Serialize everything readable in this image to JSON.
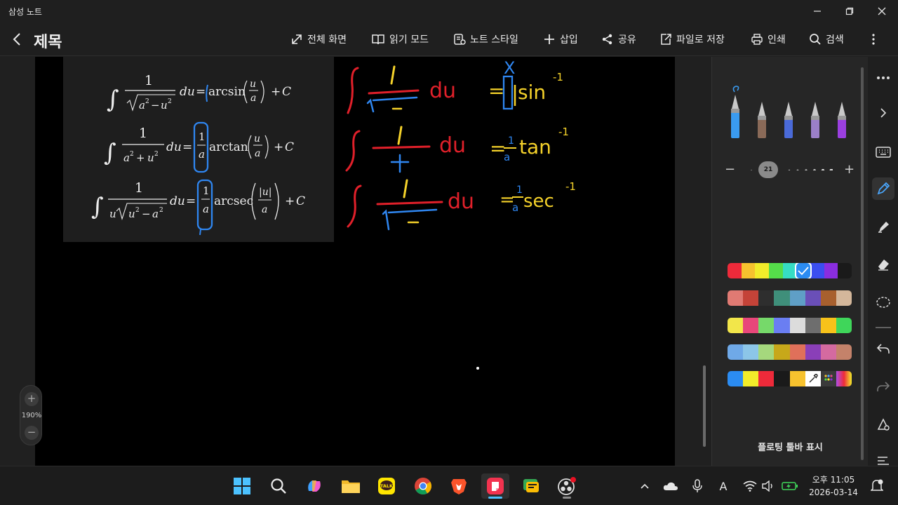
{
  "window": {
    "title": "삼성 노트",
    "controls": [
      "minimize",
      "restore",
      "close"
    ]
  },
  "toolbar": {
    "page_title": "제목",
    "items": [
      {
        "id": "fullscreen",
        "label": "전체 화면",
        "icon": "expand-icon"
      },
      {
        "id": "reading",
        "label": "읽기 모드",
        "icon": "book-icon"
      },
      {
        "id": "style",
        "label": "노트 스타일",
        "icon": "note-style-icon"
      },
      {
        "id": "insert",
        "label": "삽입",
        "icon": "plus-icon"
      },
      {
        "id": "share",
        "label": "공유",
        "icon": "share-icon"
      },
      {
        "id": "save",
        "label": "파일로 저장",
        "icon": "save-file-icon"
      },
      {
        "id": "print",
        "label": "인쇄",
        "icon": "print-icon"
      },
      {
        "id": "search",
        "label": "검색",
        "icon": "search-icon"
      }
    ]
  },
  "formulas": [
    {
      "integrand_num": "1",
      "integrand_den": "√(a² − u²)",
      "result_coef": "",
      "result_fn": "arcsin",
      "arg": "u/a",
      "tail": "+ C"
    },
    {
      "integrand_num": "1",
      "integrand_den": "a² + u²",
      "result_coef": "1/a",
      "result_fn": "arctan",
      "arg": "u/a",
      "tail": "+ C"
    },
    {
      "integrand_num": "1",
      "integrand_den": "u√(u² − a²)",
      "result_coef": "1/a",
      "result_fn": "arcsec",
      "arg": "|u|/a",
      "tail": "+ C"
    }
  ],
  "formula_text": {
    "one": "1",
    "du": "du",
    "eq": "=",
    "plus_c": "+ C",
    "C": "C",
    "plus": "+",
    "minus": "−",
    "arcsin": "arcsin",
    "arctan": "arctan",
    "arcsec": "arcsec",
    "u": "u",
    "a": "a",
    "au": "|u|",
    "sq": "2",
    "int": "∫"
  },
  "handwriting": {
    "rows": [
      {
        "fn": "sin",
        "coef": "",
        "exp": "−1",
        "mark": "x"
      },
      {
        "fn": "tan",
        "coef": "1/a",
        "exp": "−1"
      },
      {
        "fn": "sec",
        "coef": "1/a",
        "exp": "−1"
      }
    ],
    "glyphs": {
      "one": "1",
      "du": "du",
      "eq": "=",
      "a": "a",
      "exp": "-1",
      "x": "X"
    },
    "colors": {
      "red": "#e0202a",
      "yellow": "#f5d22a",
      "blue": "#2f86f0"
    }
  },
  "zoom": {
    "level": "190%",
    "plus": "+",
    "minus": "−"
  },
  "pen_panel": {
    "pens": [
      {
        "name": "fountain-pen",
        "color": "#3a9bf0",
        "selected": true
      },
      {
        "name": "pen",
        "color": "#8a6a58",
        "selected": false
      },
      {
        "name": "ballpoint-pen",
        "color": "#4a6ad8",
        "selected": false
      },
      {
        "name": "pencil",
        "color": "#9b7fc8",
        "selected": false
      },
      {
        "name": "brush",
        "color": "#9b3fe0",
        "selected": false
      }
    ],
    "size": "21",
    "size_minus": "−",
    "size_plus": "+",
    "selected_color": "#2b8cf2",
    "palette_rows": [
      [
        "#ee2a3a",
        "#f7c22e",
        "#f2ec2a",
        "#55dd4a",
        "#36ddc4",
        "#2b8cf2",
        "#3b4ef0",
        "#8a2de0",
        "#1a1a1a"
      ],
      [
        "#e07a73",
        "#c44338",
        "#2e2e2e",
        "#3f8f7a",
        "#5f9fc6",
        "#6a4fb8",
        "#a8602e",
        "#d4b79b"
      ],
      [
        "#f2e64a",
        "#e8477a",
        "#76d96a",
        "#6a7ef2",
        "#dcdcdc",
        "#6e6e6e",
        "#f7c21a",
        "#3fd65a"
      ],
      [
        "#6fa9e8",
        "#8cc6e8",
        "#a5d87d",
        "#c7a81a",
        "#e0705a",
        "#8a3fb8",
        "#d46aa0",
        "#c4826a"
      ],
      [
        "#2b8cf2",
        "#f2ec2a",
        "#ee2a3a",
        "#1a1a1a",
        "#f7c22e",
        "#ffffff",
        "#3a3a3a",
        "#b04fe8"
      ]
    ],
    "floating_label": "플로팅 툴바 표시"
  },
  "rail": [
    "more-icon",
    "chevron-right-icon",
    "keyboard-icon",
    "pen-icon",
    "highlighter-icon",
    "eraser-icon",
    "lasso-icon",
    "line-icon",
    "undo-icon",
    "redo-icon",
    "shape-icon",
    "text-align-icon"
  ],
  "taskbar": {
    "apps": [
      "windows-start-icon",
      "search-icon",
      "copilot-icon",
      "file-explorer-icon",
      "kakaotalk-icon",
      "chrome-icon",
      "brave-icon",
      "samsung-notes-icon",
      "messages-icon",
      "obs-icon"
    ],
    "kakao_label": "TALK",
    "tray_font": "A",
    "time": "오후 11:05",
    "date": "2026-03-14"
  }
}
